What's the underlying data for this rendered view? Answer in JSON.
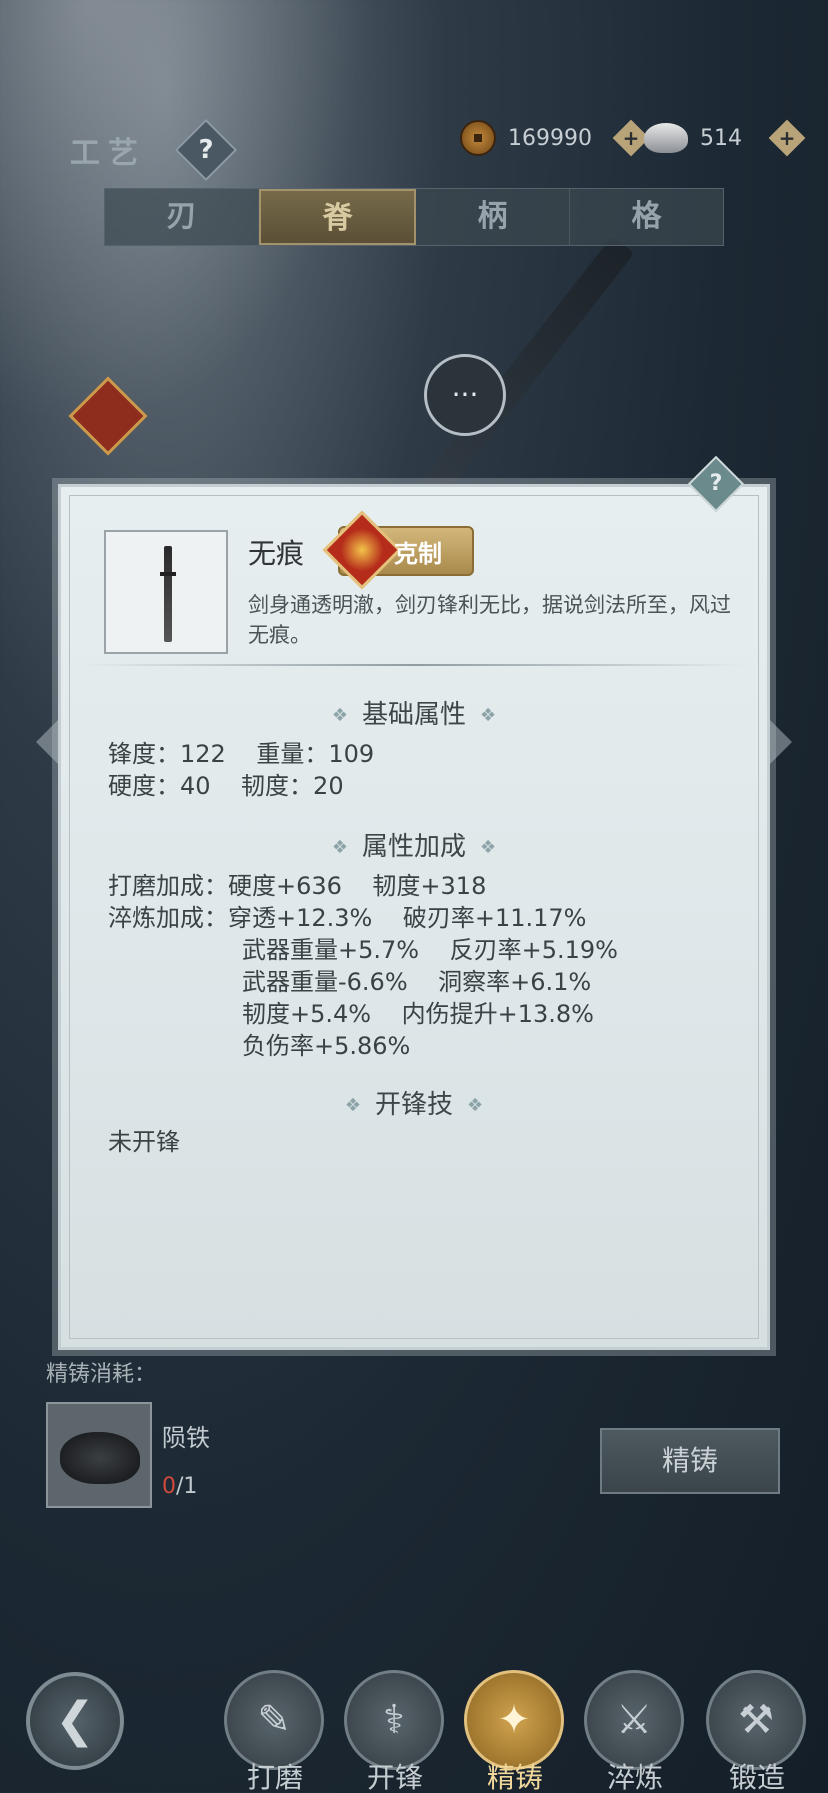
{
  "header": {
    "title": "工艺",
    "help_icon": "?",
    "currency": [
      {
        "icon": "copper-coin-icon",
        "value": "169990"
      },
      {
        "icon": "silver-ingot-icon",
        "value": "514"
      }
    ],
    "plus": "+"
  },
  "tabs": [
    {
      "label": "刃",
      "active": false
    },
    {
      "label": "脊",
      "active": true
    },
    {
      "label": "柄",
      "active": false
    },
    {
      "label": "格",
      "active": false
    }
  ],
  "panel": {
    "help": "?",
    "item_name": "无痕",
    "badge": "克制",
    "description": "剑身通透明澈，剑刃锋利无比，据说剑法所至，风过无痕。",
    "sections": {
      "base_title": "基础属性",
      "base_rows": [
        "锋度：122    重量：109",
        "硬度：40    韧度：20"
      ],
      "bonus_title": "属性加成",
      "grind_row": "打磨加成：硬度+636    韧度+318",
      "temper_label": "淬炼加成：",
      "temper_rows": [
        "穿透+12.3%    破刃率+11.17%",
        "武器重量+5.7%    反刃率+5.19%",
        "武器重量-6.6%    洞察率+6.1%",
        "韧度+5.4%    内伤提升+13.8%",
        "负伤率+5.86%"
      ],
      "skill_title": "开锋技",
      "skill_value": "未开锋"
    },
    "diamond_glyph": "❖"
  },
  "cost": {
    "label": "精铸消耗：",
    "material_name": "陨铁",
    "owned": "0",
    "required": "/1",
    "button": "精铸"
  },
  "bottom_nav": {
    "back_glyph": "❮",
    "items": [
      {
        "label": "打磨",
        "glyph": "✎",
        "active": false
      },
      {
        "label": "开锋",
        "glyph": "⚕",
        "active": false
      },
      {
        "label": "精铸",
        "glyph": "✦",
        "active": true
      },
      {
        "label": "淬炼",
        "glyph": "⚔",
        "active": false
      },
      {
        "label": "锻造",
        "glyph": "⚒",
        "active": false
      }
    ]
  },
  "chat_glyph": "···"
}
